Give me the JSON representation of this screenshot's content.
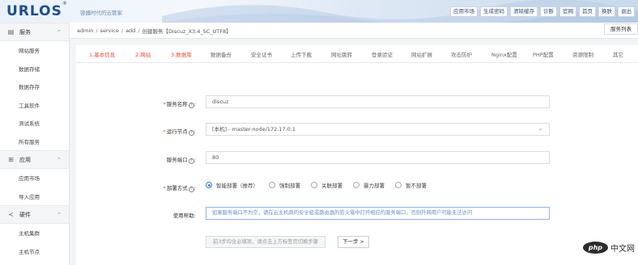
{
  "header": {
    "logo": "URLOS",
    "logo_mark": "®",
    "tagline": "容器时代的云管家",
    "nav": [
      "应用市场",
      "生成密码",
      "清除缓存",
      "诊断",
      "官网",
      "首页",
      "换肤",
      "退出"
    ]
  },
  "sidebar": {
    "groups": [
      {
        "label": "服务",
        "icon": "server-icon",
        "items": [
          "网站服务",
          "数据存储",
          "数据存存",
          "工具软件",
          "测试系统",
          "所有服务"
        ]
      },
      {
        "label": "应用",
        "icon": "grid-icon",
        "items": [
          "应用市场",
          "导入应用"
        ]
      },
      {
        "label": "硬件",
        "icon": "share-icon",
        "items": [
          "主机集群",
          "主机节点"
        ]
      }
    ]
  },
  "breadcrumb": [
    "admin",
    "service",
    "add",
    "创建服务【Discuz_X3.4_SC_UTF8】"
  ],
  "service_list_button": "服务列表",
  "tabs": [
    "1.基本信息",
    "2.网站",
    "3.数据库",
    "数据备份",
    "安全证书",
    "上传下载",
    "网址跳转",
    "登录验证",
    "网站扩展",
    "攻击防护",
    "Nginx配置",
    "PHP配置",
    "资源限制",
    "其它"
  ],
  "form": {
    "service_name": {
      "label": "服务名称",
      "value": "discuz"
    },
    "run_node": {
      "label": "运行节点",
      "value": "[本机] - master-node/172.17.0.1"
    },
    "service_port": {
      "label": "服务端口",
      "value": "80"
    },
    "deploy": {
      "label": "部署方式",
      "options": [
        "智能部署（推荐）",
        "强制部署",
        "关联部署",
        "暴力部署",
        "暂不部署"
      ],
      "selected": "智能部署（推荐）"
    },
    "help": {
      "label": "使用帮助:",
      "text": "如果服务端口不为空，请在云主机商的安全组或路由器的防火墙中打开相应的服务端口，否则外网用户可能无法访问"
    },
    "prev_button": "前3步均含必填项，请点击上方标签页切换步骤",
    "next_button": "下一步 >"
  },
  "watermark": {
    "brand": "php",
    "suffix": "中文网"
  },
  "colors": {
    "accent": "#e94b3c",
    "link": "#3a7bd5",
    "brand": "#1d4f8c"
  }
}
